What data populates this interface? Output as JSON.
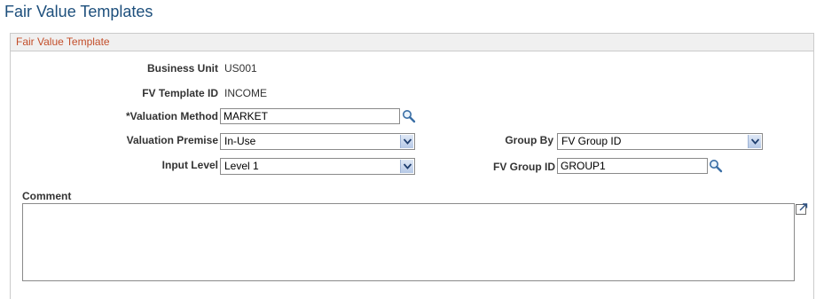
{
  "page": {
    "title": "Fair Value Templates"
  },
  "group": {
    "title": "Fair Value Template"
  },
  "fields": {
    "business_unit": {
      "label": "Business Unit",
      "value": "US001"
    },
    "fv_template_id": {
      "label": "FV Template ID",
      "value": "INCOME"
    },
    "valuation_method": {
      "label": "*Valuation Method",
      "value": "MARKET"
    },
    "valuation_premise": {
      "label": "Valuation Premise",
      "value": "In-Use"
    },
    "input_level": {
      "label": "Input Level",
      "value": "Level 1"
    },
    "group_by": {
      "label": "Group By",
      "value": "FV Group ID"
    },
    "fv_group_id": {
      "label": "FV Group ID",
      "value": "GROUP1"
    },
    "comment": {
      "label": "Comment",
      "value": ""
    }
  },
  "icons": {
    "lookup": "magnifier-icon",
    "dropdown": "chevron-down-icon",
    "expand": "expand-icon"
  },
  "colors": {
    "title": "#1d4f7c",
    "group_header_text": "#c34e2a",
    "group_header_bg": "#f0f0f0"
  }
}
